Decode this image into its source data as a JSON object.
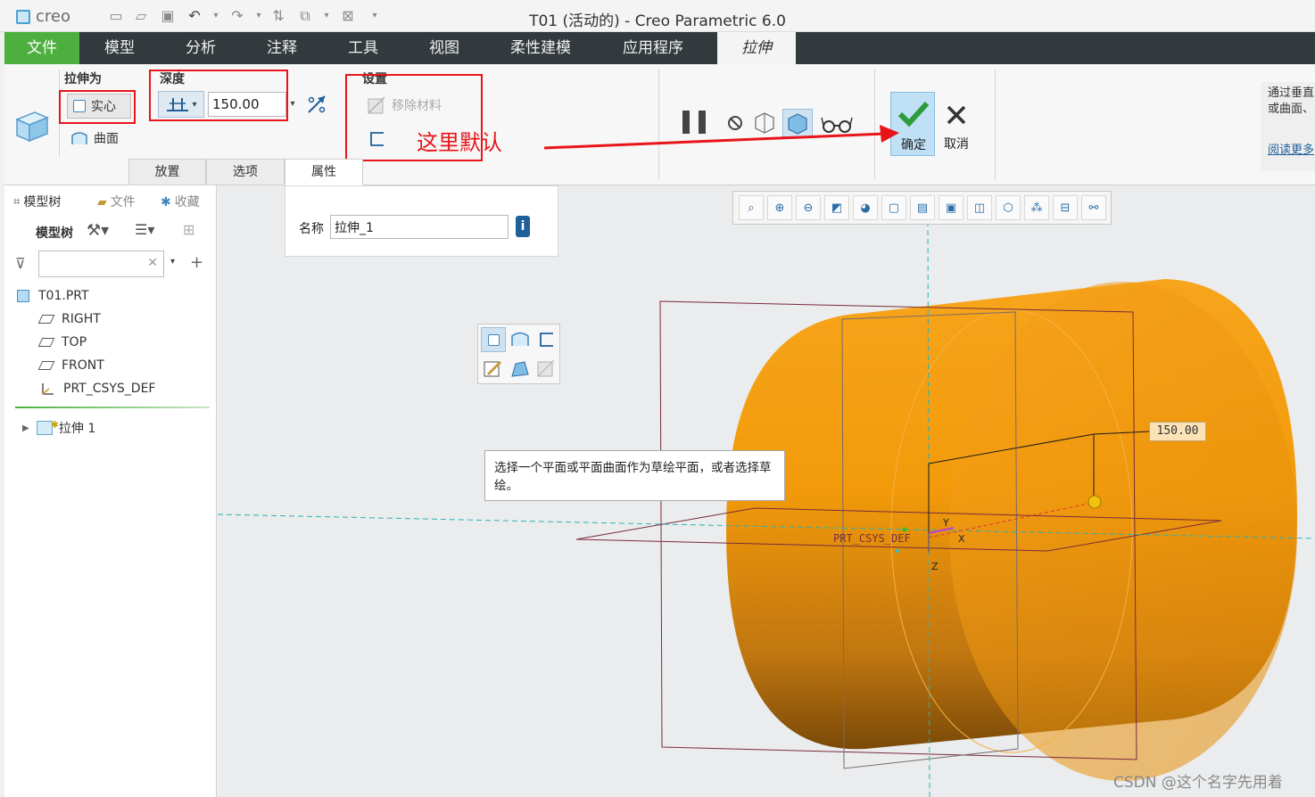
{
  "window": {
    "title": "T01 (活动的) - Creo Parametric 6.0",
    "logo": "creo"
  },
  "menu": {
    "tabs": [
      "文件",
      "模型",
      "分析",
      "注释",
      "工具",
      "视图",
      "柔性建模",
      "应用程序",
      "拉伸"
    ]
  },
  "ribbon": {
    "extrude_as_label": "拉伸为",
    "solid_label": "实心",
    "surface_label": "曲面",
    "depth_label": "深度",
    "depth_value": "150.00",
    "settings_label": "设置",
    "remove_material_label": "移除材料",
    "annotation_text": "这里默认",
    "ok_label": "确定",
    "cancel_label": "取消",
    "subtabs": [
      "放置",
      "选项",
      "属性"
    ],
    "help_text_line1": "通过垂直",
    "help_text_line2": "或曲面、",
    "help_link": "阅读更多"
  },
  "properties": {
    "name_label": "名称",
    "name_value": "拉伸_1"
  },
  "left_panel": {
    "tabs": [
      "模型树",
      "文件",
      "收藏"
    ],
    "tree_header": "模型树",
    "filter_placeholder": "",
    "tree_items": [
      "T01.PRT",
      "RIGHT",
      "TOP",
      "FRONT",
      "PRT_CSYS_DEF"
    ],
    "feature_item": "拉伸 1"
  },
  "viewport": {
    "tooltip": "选择一个平面或平面曲面作为草绘平面，或者选择草绘。",
    "dimension_value": "150.00",
    "csys_label": "PRT_CSYS_DEF",
    "axis_x": "X",
    "axis_y": "Y",
    "axis_z": "Z",
    "body_color": "#f29a0a"
  },
  "watermark": "CSDN @这个名字先用着"
}
